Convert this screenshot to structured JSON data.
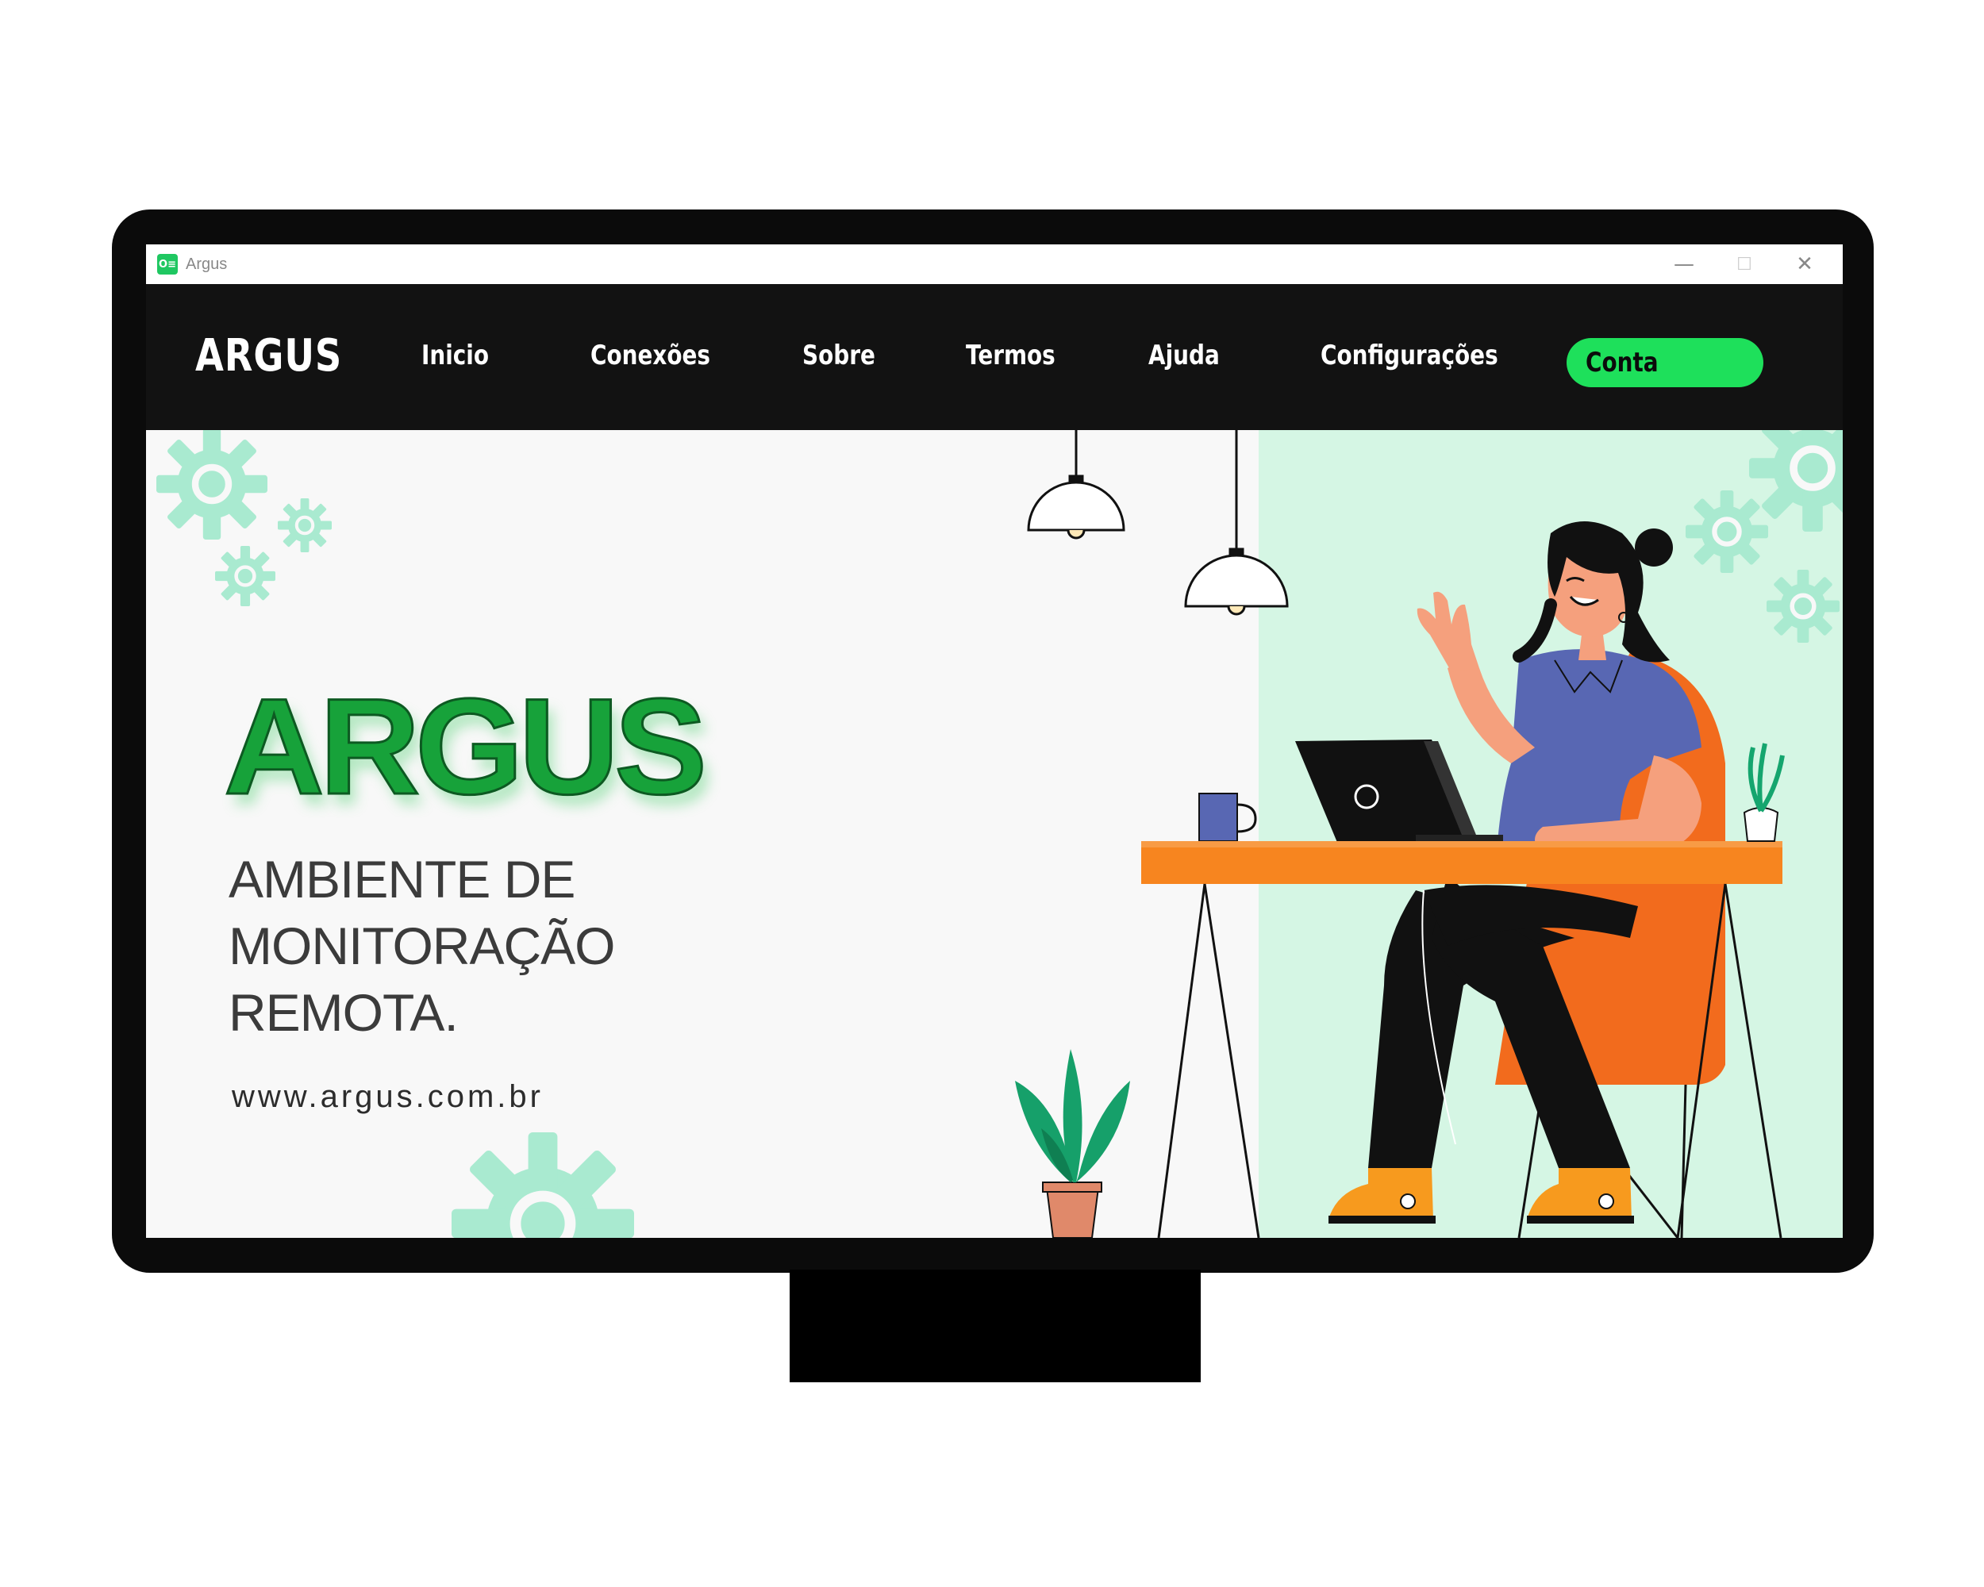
{
  "window": {
    "title": "Argus",
    "icon_text": "O≡",
    "controls": {
      "minimize": "—",
      "maximize": "☐",
      "close": "✕"
    }
  },
  "nav": {
    "logo": "ARGUS",
    "links": [
      "Inicio",
      "Conexões",
      "Sobre",
      "Termos",
      "Ajuda",
      "Configurações"
    ],
    "account_button": "Conta"
  },
  "hero": {
    "title": "ARGUS",
    "subtitle_lines": [
      "AMBIENTE DE",
      "MONITORAÇÃO",
      "REMOTA."
    ],
    "url": "www.argus.com.br"
  },
  "colors": {
    "brand_green": "#17a23a",
    "accent_button": "#1ee05b",
    "nav_bg": "#121212",
    "hero_right_bg": "#d5f6e4",
    "gear_color": "#a9ead0",
    "desk_orange": "#f7851f",
    "shirt_blue": "#5867b3"
  },
  "icons": [
    "app-icon",
    "gear-icon",
    "lamp-icon",
    "laptop-icon",
    "mug-icon",
    "plant-icon"
  ]
}
